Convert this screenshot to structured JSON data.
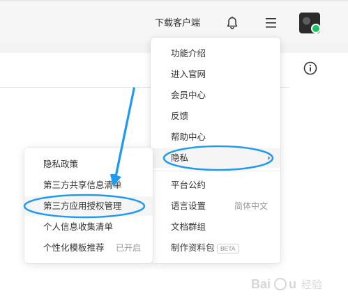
{
  "topbar": {
    "download_label": "下载客户端",
    "bell_icon": "bell-icon",
    "menu_icon": "hamburger-menu-icon",
    "info_icon": "info-icon"
  },
  "main_menu": {
    "items": [
      {
        "label": "功能介绍"
      },
      {
        "label": "进入官网"
      },
      {
        "label": "会员中心"
      },
      {
        "label": "反馈"
      },
      {
        "label": "帮助中心"
      },
      {
        "label": "隐私",
        "has_submenu": true
      },
      {
        "label": "平台公约"
      },
      {
        "label": "语言设置",
        "value": "简体中文"
      },
      {
        "label": "文档群组"
      },
      {
        "label": "制作资料包",
        "badge": "BETA"
      }
    ]
  },
  "privacy_submenu": {
    "items": [
      {
        "label": "隐私政策"
      },
      {
        "label": "第三方共享信息清单"
      },
      {
        "label": "第三方应用授权管理"
      },
      {
        "label": "个人信息收集清单"
      },
      {
        "label": "个性化模板推荐",
        "value": "已开启"
      }
    ]
  },
  "colors": {
    "annotation": "#1e9af0",
    "text": "#333333",
    "muted": "#999999",
    "badge_green": "#17c45f"
  },
  "watermark": {
    "text": "Baidu 经验"
  }
}
